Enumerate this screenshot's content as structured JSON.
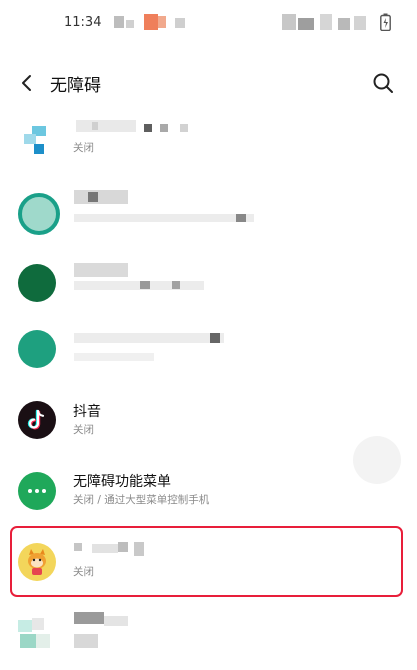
{
  "status_bar": {
    "time": "11:34"
  },
  "header": {
    "title": "无障碍"
  },
  "items": [
    {
      "title": "",
      "subtitle": "关闭"
    },
    {
      "title": "",
      "subtitle": ""
    },
    {
      "title": "",
      "subtitle": ""
    },
    {
      "title": "",
      "subtitle": ""
    },
    {
      "title": "抖音",
      "subtitle": "关闭"
    },
    {
      "title": "无障碍功能菜单",
      "subtitle": "关闭 / 通过大型菜单控制手机"
    },
    {
      "title": "",
      "subtitle": "关闭"
    },
    {
      "title": "",
      "subtitle": ""
    }
  ],
  "icons": {
    "back": "back-arrow-icon",
    "search": "search-icon",
    "menu_app": "three-dots-icon",
    "tiktok": "tiktok-icon",
    "highlighted_app": "cartoon-face-icon"
  },
  "colors": {
    "highlight_border": "#e81e3a",
    "menu_green": "#1fa85a",
    "tiktok_bg": "#1a0f14"
  }
}
